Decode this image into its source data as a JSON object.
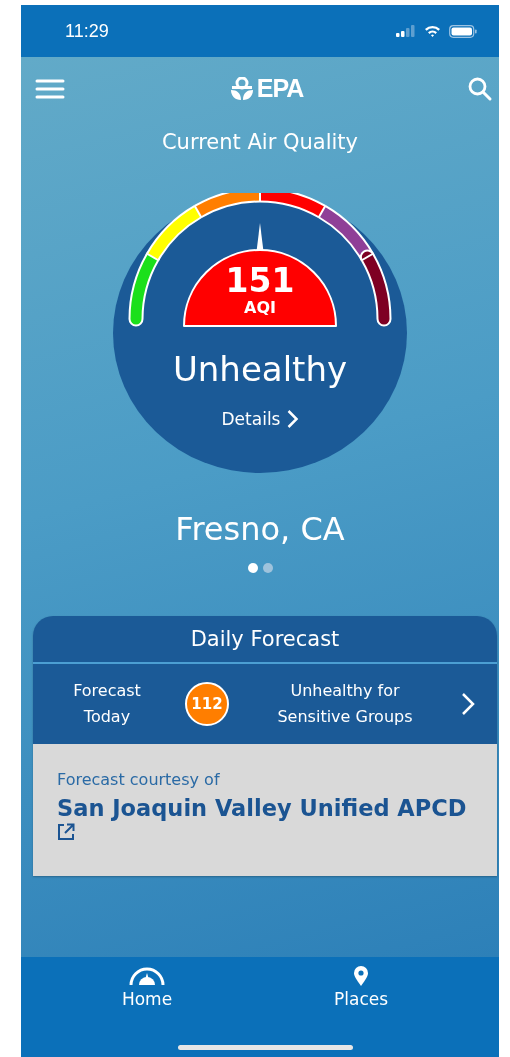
{
  "status_bar": {
    "time": "11:29"
  },
  "header": {
    "logo_text": "EPA"
  },
  "title": "Current Air Quality",
  "gauge": {
    "segments": [
      {
        "color": "#1be01b"
      },
      {
        "color": "#ffff00"
      },
      {
        "color": "#ff7e00"
      },
      {
        "color": "#ff0000"
      },
      {
        "color": "#8f3f97"
      },
      {
        "color": "#7e0023"
      }
    ],
    "level": 0.5,
    "aqi": "151",
    "unit": "AQI",
    "color": "#ff0000",
    "category": "Unhealthy",
    "details_link": "Details"
  },
  "location": "Fresno, CA",
  "pages": [
    {
      "selected": true
    },
    {
      "selected": false
    }
  ],
  "daily_forecast": {
    "title": "Daily Forecast",
    "label": "Forecast Today",
    "aqi": "112",
    "color": "#ff7e00",
    "category": "Unhealthy for Sensitive Groups",
    "credit_label": "Forecast courtesy of",
    "source_link": "San Joaquin Valley Unified APCD"
  },
  "tabs": [
    {
      "label": "Home",
      "kind": "gauge"
    },
    {
      "label": "Places",
      "kind": "pin"
    }
  ]
}
